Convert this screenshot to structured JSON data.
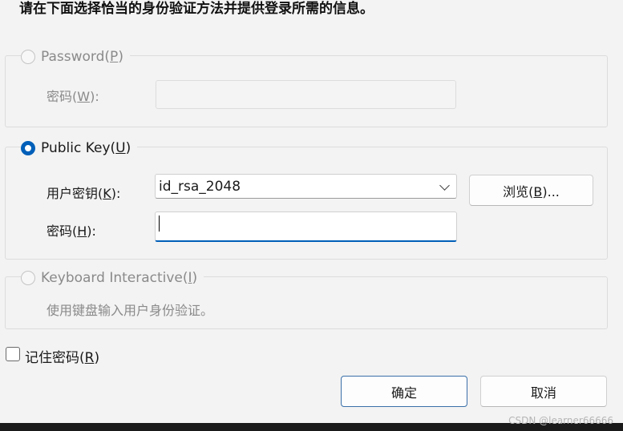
{
  "header": {
    "text": "请在下面选择恰当的身份验证方法并提供登录所需的信息。"
  },
  "password_group": {
    "label": "Password(",
    "mnemonic": "P",
    "label_end": ")",
    "field_label": "密码(",
    "field_mnemonic": "W",
    "field_label_end": "):",
    "enabled": false
  },
  "publickey_group": {
    "label": "Public Key(",
    "mnemonic": "U",
    "label_end": ")",
    "selected": true,
    "key_label": "用户密钥(",
    "key_mnemonic": "K",
    "key_label_end": "):",
    "key_value": "id_rsa_2048",
    "browse_label": "浏览(",
    "browse_mnemonic": "B",
    "browse_label_end": ")...",
    "pass_label": "密码(",
    "pass_mnemonic": "H",
    "pass_label_end": "):",
    "pass_value": ""
  },
  "keyboard_group": {
    "label": "Keyboard Interactive(",
    "mnemonic": "I",
    "label_end": ")",
    "description": "使用键盘输入用户身份验证。",
    "enabled": false
  },
  "remember": {
    "label": "记住密码(",
    "mnemonic": "R",
    "label_end": ")",
    "checked": false
  },
  "buttons": {
    "ok": "确定",
    "cancel": "取消"
  },
  "watermark": "CSDN @learner66666",
  "colors": {
    "accent": "#005fb8",
    "disabled_text": "#8a8a8a",
    "background": "#f3f3f3"
  }
}
